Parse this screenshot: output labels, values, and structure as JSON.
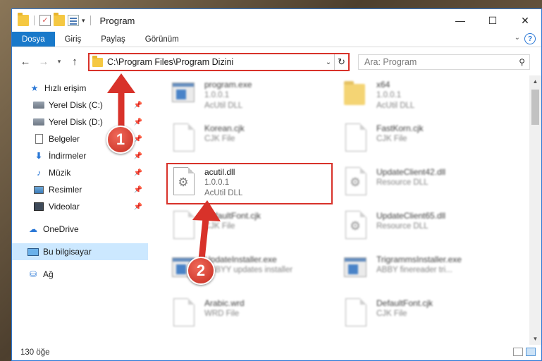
{
  "window": {
    "title": "Program",
    "controls": {
      "minimize": "—",
      "maximize": "☐",
      "close": "✕"
    }
  },
  "ribbon": {
    "tabs": [
      "Dosya",
      "Giriş",
      "Paylaş",
      "Görünüm"
    ],
    "help": "?"
  },
  "address": {
    "path": "C:\\Program Files\\Program Dizini",
    "search_placeholder": "Ara: Program"
  },
  "navpane": {
    "items": [
      {
        "label": "Hızlı erişim",
        "icon": "star-icon"
      },
      {
        "label": "Yerel Disk (C:)",
        "icon": "drive-icon",
        "pinned": true
      },
      {
        "label": "Yerel Disk (D:)",
        "icon": "drive-icon",
        "pinned": true
      },
      {
        "label": "Belgeler",
        "icon": "document-icon",
        "pinned": true
      },
      {
        "label": "İndirmeler",
        "icon": "download-icon",
        "pinned": true
      },
      {
        "label": "Müzik",
        "icon": "music-icon",
        "pinned": true
      },
      {
        "label": "Resimler",
        "icon": "pictures-icon",
        "pinned": true
      },
      {
        "label": "Videolar",
        "icon": "videos-icon",
        "pinned": true
      },
      {
        "label": "OneDrive",
        "icon": "cloud-icon"
      },
      {
        "label": "Bu bilgisayar",
        "icon": "computer-icon",
        "selected": true
      },
      {
        "label": "Ağ",
        "icon": "network-icon"
      }
    ]
  },
  "files": [
    {
      "name": "program.exe",
      "line2": "1.0.0.1",
      "line3": "AcUtil DLL",
      "icon": "exe-icon"
    },
    {
      "name": "x64",
      "line2": "1.0.0.1",
      "line3": "AcUtil DLL",
      "icon": "folder-icon"
    },
    {
      "name": "Korean.cjk",
      "line2": "CJK File",
      "line3": "",
      "icon": "file-icon"
    },
    {
      "name": "FastKorn.cjk",
      "line2": "CJK File",
      "line3": "",
      "icon": "file-icon"
    },
    {
      "name": "acutil.dll",
      "line2": "1.0.0.1",
      "line3": "AcUtil DLL",
      "icon": "dll-icon",
      "highlighted": true
    },
    {
      "name": "UpdateClient42.dll",
      "line2": "Resource DLL",
      "line3": "",
      "icon": "dll-icon"
    },
    {
      "name": "DefaultFont.cjk",
      "line2": "CJK File",
      "line3": "",
      "icon": "file-icon"
    },
    {
      "name": "UpdateClient65.dll",
      "line2": "Resource DLL",
      "line3": "",
      "icon": "dll-icon"
    },
    {
      "name": "UpdateInstaller.exe",
      "line2": "ABBYY updates installer",
      "line3": "",
      "icon": "exe-icon"
    },
    {
      "name": "TrigrammsInstaller.exe",
      "line2": "ABBY finereader tri...",
      "line3": "",
      "icon": "exe-icon"
    },
    {
      "name": "Arabic.wrd",
      "line2": "WRD File",
      "line3": "",
      "icon": "file-icon"
    },
    {
      "name": "DefaultFont.cjk",
      "line2": "CJK File",
      "line3": "",
      "icon": "file-icon"
    }
  ],
  "status": {
    "count": "130 öğe"
  },
  "annotations": {
    "step1": "1",
    "step2": "2"
  },
  "colors": {
    "accent": "#1979ca",
    "highlight": "#d8322a",
    "selected": "#cce8ff"
  }
}
